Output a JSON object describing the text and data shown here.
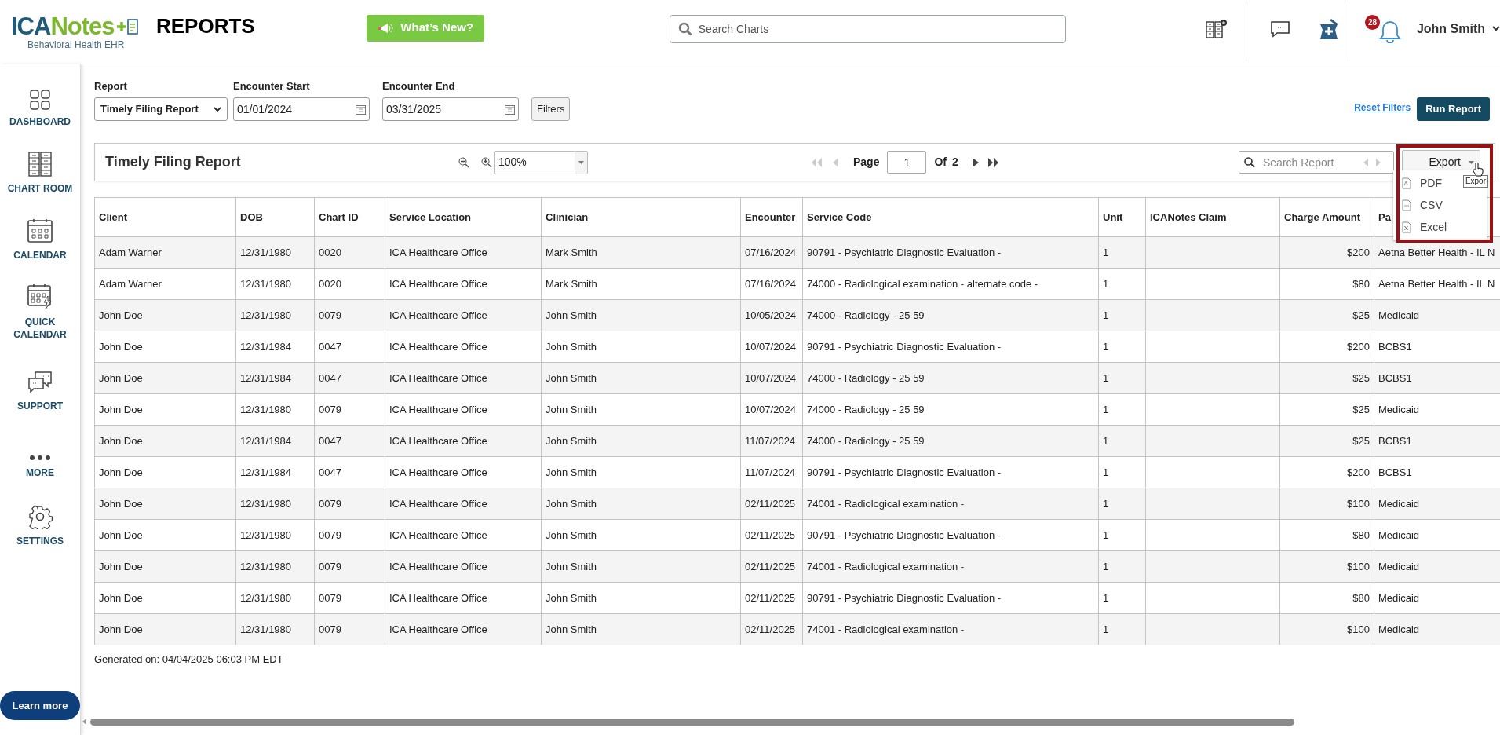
{
  "header": {
    "brand_part_1": "ICA",
    "brand_part_2": "Notes",
    "tagline": "Behavioral Health EHR",
    "page_title": "REPORTS",
    "whats_new_button": "What’s New?",
    "search": {
      "placeholder": "Search Charts"
    },
    "notification_count": "28",
    "user_name": "John Smith"
  },
  "sidebar": {
    "items": [
      {
        "label": "DASHBOARD",
        "kind": "dashboard"
      },
      {
        "label": "CHART ROOM",
        "kind": "chart_room"
      },
      {
        "label": "CALENDAR",
        "kind": "calendar"
      },
      {
        "label": "QUICK CALENDAR",
        "kind": "quick_calendar"
      },
      {
        "label": "SUPPORT",
        "kind": "support"
      },
      {
        "label": "MORE",
        "kind": "more"
      },
      {
        "label": "SETTINGS",
        "kind": "settings"
      }
    ],
    "learn_more_button": "Learn more"
  },
  "filters": {
    "report": {
      "label": "Report",
      "value": "Timely Filing Report"
    },
    "encounter_start": {
      "label": "Encounter Start",
      "value": "01/01/2024"
    },
    "encounter_end": {
      "label": "Encounter End",
      "value": "03/31/2025"
    },
    "filters_button": "Filters",
    "reset_link": "Reset Filters",
    "run_button": "Run Report"
  },
  "report_toolbar": {
    "title": "Timely Filing Report",
    "zoom": "100%",
    "page_label": "Page",
    "page": "1",
    "of_label": "Of",
    "page_count": "2",
    "search": {
      "placeholder": "Search Report"
    },
    "export_button": "Export",
    "tooltip": "Expor",
    "export_menu": [
      {
        "label": "PDF",
        "kind": "pdf"
      },
      {
        "label": "CSV",
        "kind": "csv"
      },
      {
        "label": "Excel",
        "kind": "excel"
      }
    ]
  },
  "table": {
    "columns": [
      "Client",
      "DOB",
      "Chart ID",
      "Service Location",
      "Clinician",
      "Encounter",
      "Service Code",
      "Unit",
      "ICANotes Claim",
      "Charge Amount",
      "Pa"
    ],
    "rows": [
      [
        "Adam Warner",
        "12/31/1980",
        "0020",
        "ICA Healthcare Office",
        "Mark Smith",
        "07/16/2024",
        "90791 -  Psychiatric Diagnostic Evaluation -",
        "1",
        "",
        "$200",
        "Aetna Better Health - IL N"
      ],
      [
        "Adam Warner",
        "12/31/1980",
        "0020",
        "ICA Healthcare Office",
        "Mark Smith",
        "07/16/2024",
        "74000 -  Radiological examination - alternate code -",
        "1",
        "",
        "$80",
        "Aetna Better Health - IL N"
      ],
      [
        "John Doe",
        "12/31/1980",
        "0079",
        "ICA Healthcare Office",
        "John Smith",
        "10/05/2024",
        "74000 -  Radiology - 25 59",
        "1",
        "",
        "$25",
        "Medicaid"
      ],
      [
        "John Doe",
        "12/31/1984",
        "0047",
        "ICA Healthcare Office",
        "John Smith",
        "10/07/2024",
        "90791 -  Psychiatric Diagnostic Evaluation -",
        "1",
        "",
        "$200",
        "BCBS1"
      ],
      [
        "John Doe",
        "12/31/1984",
        "0047",
        "ICA Healthcare Office",
        "John Smith",
        "10/07/2024",
        "74000 -  Radiology - 25 59",
        "1",
        "",
        "$25",
        "BCBS1"
      ],
      [
        "John Doe",
        "12/31/1980",
        "0079",
        "ICA Healthcare Office",
        "John Smith",
        "10/07/2024",
        "74000 -  Radiology - 25 59",
        "1",
        "",
        "$25",
        "Medicaid"
      ],
      [
        "John Doe",
        "12/31/1984",
        "0047",
        "ICA Healthcare Office",
        "John Smith",
        "11/07/2024",
        "74000 -  Radiology - 25 59",
        "1",
        "",
        "$25",
        "BCBS1"
      ],
      [
        "John Doe",
        "12/31/1984",
        "0047",
        "ICA Healthcare Office",
        "John Smith",
        "11/07/2024",
        "90791 -  Psychiatric Diagnostic Evaluation -",
        "1",
        "",
        "$200",
        "BCBS1"
      ],
      [
        "John Doe",
        "12/31/1980",
        "0079",
        "ICA Healthcare Office",
        "John Smith",
        "02/11/2025",
        "74001 -  Radiological examination -",
        "1",
        "",
        "$100",
        "Medicaid"
      ],
      [
        "John Doe",
        "12/31/1980",
        "0079",
        "ICA Healthcare Office",
        "John Smith",
        "02/11/2025",
        "90791 -  Psychiatric Diagnostic Evaluation -",
        "1",
        "",
        "$80",
        "Medicaid"
      ],
      [
        "John Doe",
        "12/31/1980",
        "0079",
        "ICA Healthcare Office",
        "John Smith",
        "02/11/2025",
        "74001 -  Radiological examination -",
        "1",
        "",
        "$100",
        "Medicaid"
      ],
      [
        "John Doe",
        "12/31/1980",
        "0079",
        "ICA Healthcare Office",
        "John Smith",
        "02/11/2025",
        "90791 -  Psychiatric Diagnostic Evaluation -",
        "1",
        "",
        "$80",
        "Medicaid"
      ],
      [
        "John Doe",
        "12/31/1980",
        "0079",
        "ICA Healthcare Office",
        "John Smith",
        "02/11/2025",
        "74001 -  Radiological examination -",
        "1",
        "",
        "$100",
        "Medicaid"
      ]
    ]
  },
  "footer_note": "Generated on: 04/04/2025 06:03 PM EDT"
}
